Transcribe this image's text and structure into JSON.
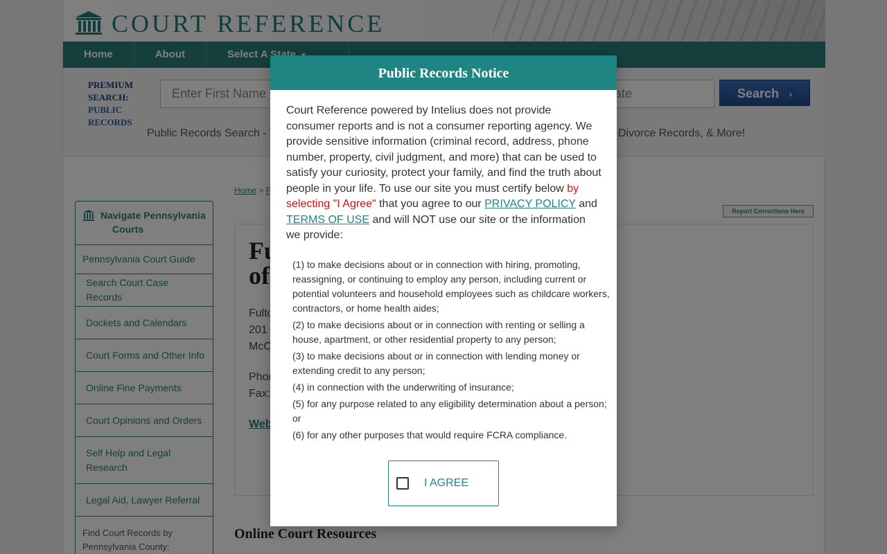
{
  "brand": {
    "name": "COURT REFERENCE",
    "teal": "#2a7e7b",
    "modal_teal": "#1f8583"
  },
  "nav": {
    "items": [
      {
        "label": "Home"
      },
      {
        "label": "About"
      },
      {
        "label": "Select A State"
      }
    ]
  },
  "search": {
    "premium_label_1": "PREMIUM",
    "premium_label_2": "SEARCH:",
    "premium_label_3": "PUBLIC",
    "premium_label_4": "RECORDS",
    "first_name_placeholder": "Enter First Name",
    "state_placeholder": "tate",
    "button_label": "Search",
    "tagline_left": "Public Records Search - Y",
    "tagline_right": "Divorce Records, & More!"
  },
  "breadcrumb": {
    "home": "Home",
    "sep": " > ",
    "next": "P"
  },
  "report_button": "Report Corrections Here",
  "sidebar": {
    "title_line1": "Navigate Pennsylvania",
    "title_line2": "Courts",
    "items": [
      {
        "label": "Pennsylvania Court Guide"
      },
      {
        "label": "Search Court Case Records"
      },
      {
        "label": "Dockets and Calendars"
      },
      {
        "label": "Court Forms and Other Info"
      },
      {
        "label": "Online Fine Payments"
      },
      {
        "label": "Court Opinions and Orders"
      },
      {
        "label": "Self Help and Legal Research"
      },
      {
        "label": "Legal Aid, Lawyer Referral"
      }
    ],
    "footer": "Find Court Records by Pennsylvania County:"
  },
  "main": {
    "title_line1": "Fu",
    "title_line2": "of",
    "addr1": "Fulto",
    "addr2": "201",
    "addr3": "McC",
    "phone": "Phon",
    "fax": "Fax:",
    "web": "Web",
    "section_title": "Online Court Resources"
  },
  "modal": {
    "title": "Public Records Notice",
    "body_part1": "Court Reference powered by Intelius does not provide consumer reports and is not a consumer reporting agency. We provide sensitive information (criminal record, address, phone number, property, civil judgment, and more) that can be used to satisfy your curiosity, protect your family, and find the truth about people in your life. To use our site you must certify below ",
    "body_red": "by selecting \"I Agree\"",
    "body_part2": " that you agree to our ",
    "privacy_link": "PRIVACY POLICY",
    "body_and": " and ",
    "terms_link": "TERMS OF USE",
    "body_part3": " and will NOT use our site or the information we provide:",
    "list": [
      "(1) to make decisions about or in connection with hiring, promoting, reassigning, or continuing to employ any person, including current or potential volunteers and household employees such as childcare workers, contractors, or home health aides;",
      "(2) to make decisions about or in connection with renting or selling a house, apartment, or other residential property to any person;",
      "(3) to make decisions about or in connection with lending money or extending credit to any person;",
      "(4) in connection with the underwriting of insurance;",
      "(5) for any purpose related to any eligibility determination about a person; or",
      "(6) for any other purposes that would require FCRA compliance."
    ],
    "agree_label": "I AGREE"
  },
  "icons": {
    "logo": "courthouse-icon",
    "sidebar": "courthouse-icon",
    "search_chevron": "chevron-right-icon",
    "nav_caret": "caret-down-icon"
  }
}
